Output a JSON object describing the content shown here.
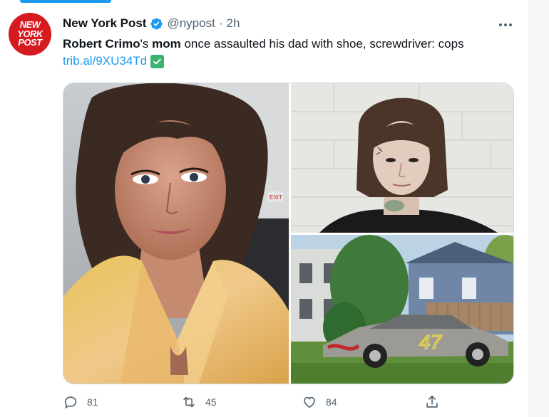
{
  "tweet": {
    "avatar_lines": [
      "NEW",
      "YORK",
      "POST"
    ],
    "display_name": "New York Post",
    "handle": "@nypost",
    "separator": "·",
    "time": "2h",
    "text_parts": [
      "Robert Crimo",
      "'s ",
      "mom",
      " once assaulted his dad with shoe, screwdriver: cops"
    ],
    "link": "trib.al/9XU34Td"
  },
  "media": {
    "top_right_sign": "EXIT",
    "car_number": "47"
  },
  "actions": {
    "replies": "81",
    "retweets": "45",
    "likes": "84"
  },
  "colors": {
    "accent": "#1d9bf0",
    "brand_red": "#d71920",
    "muted": "#536471"
  },
  "icons": [
    "verified-badge-icon",
    "more-icon",
    "check-emoji-icon",
    "reply-icon",
    "retweet-icon",
    "like-icon",
    "share-icon"
  ]
}
